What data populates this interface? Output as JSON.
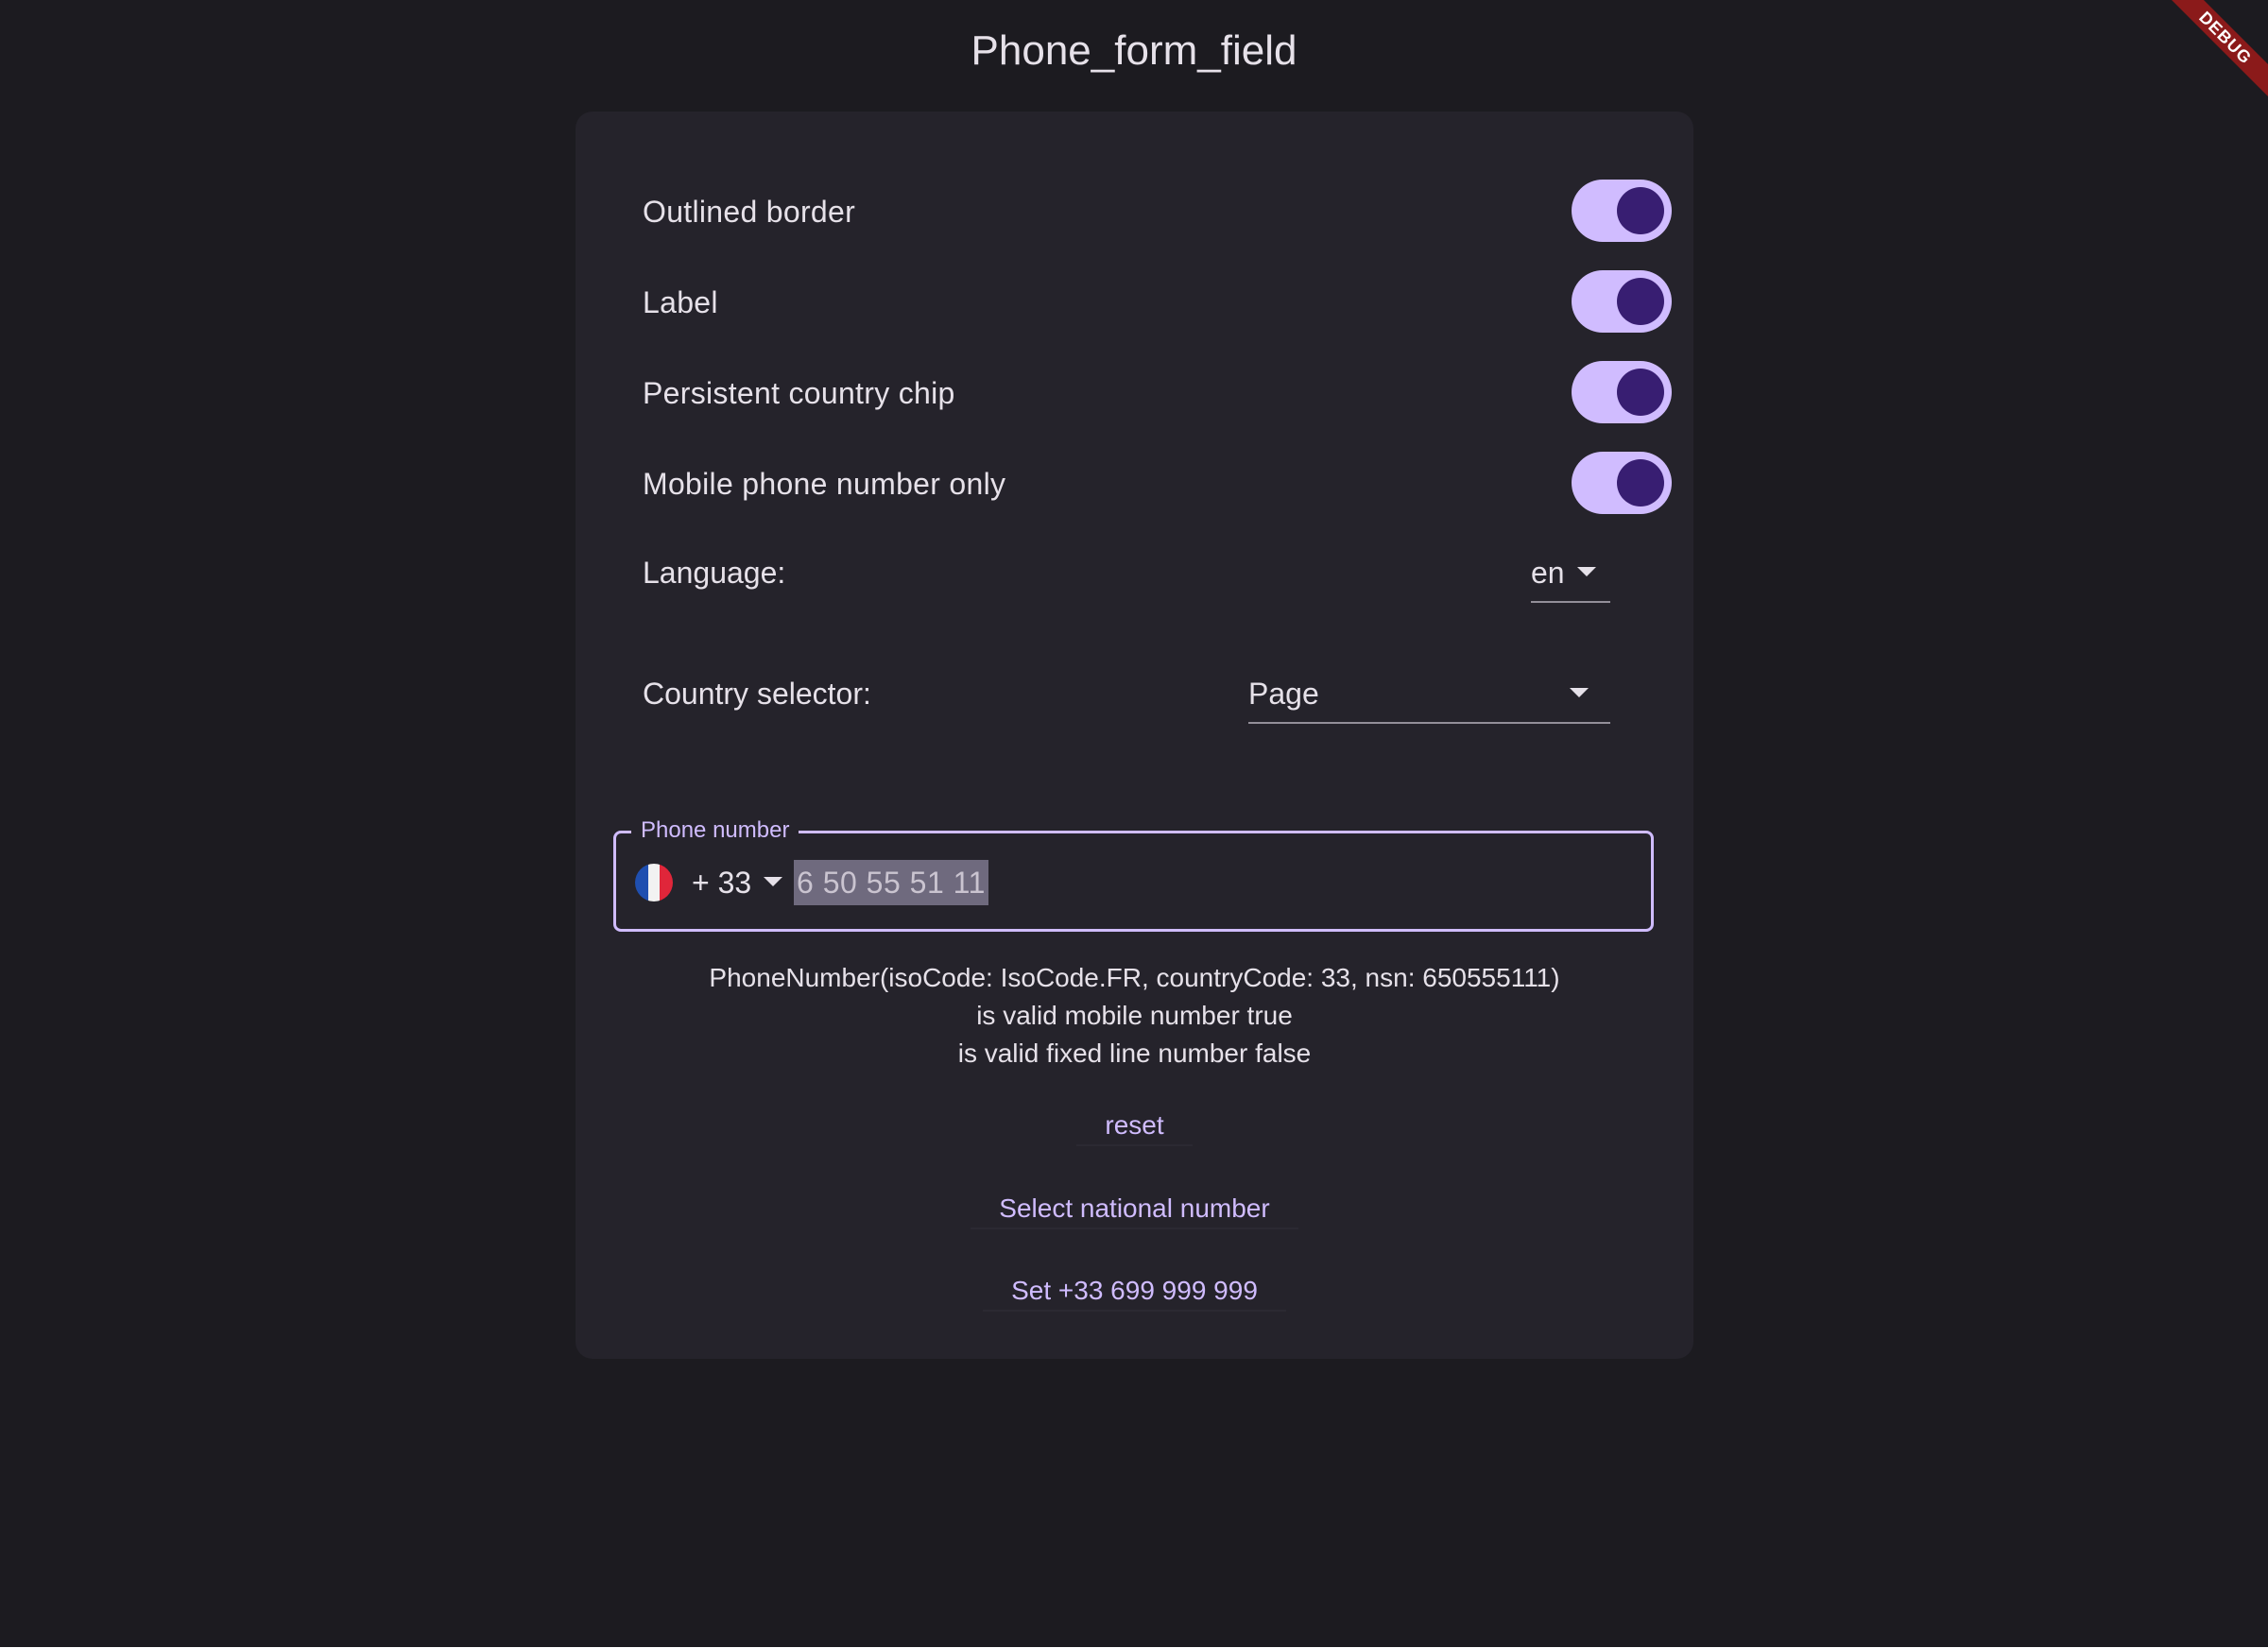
{
  "app": {
    "title": "Phone_form_field",
    "debug_banner": "DEBUG"
  },
  "switches": [
    {
      "label": "Outlined border",
      "on": true
    },
    {
      "label": "Label",
      "on": true
    },
    {
      "label": "Persistent country chip",
      "on": true
    },
    {
      "label": "Mobile phone number only",
      "on": true
    }
  ],
  "language": {
    "label": "Language:",
    "value": "en"
  },
  "country_selector": {
    "label": "Country selector:",
    "value": "Page"
  },
  "phone_field": {
    "label": "Phone number",
    "flag": "france-flag-icon",
    "country_code": "+ 33",
    "value": "6 50 55 51 11"
  },
  "result": {
    "line1": "PhoneNumber(isoCode: IsoCode.FR, countryCode: 33, nsn: 650555111)",
    "line2": "is valid mobile number true",
    "line3": "is valid fixed line number false"
  },
  "buttons": {
    "reset": "reset",
    "select_national": "Select national number",
    "set_number": "Set +33 699 999 999"
  },
  "colors": {
    "background": "#1c1b20",
    "card": "#25232b",
    "accent": "#d0bcff",
    "switch_knob": "#381e72",
    "text": "#e6e1e9"
  }
}
